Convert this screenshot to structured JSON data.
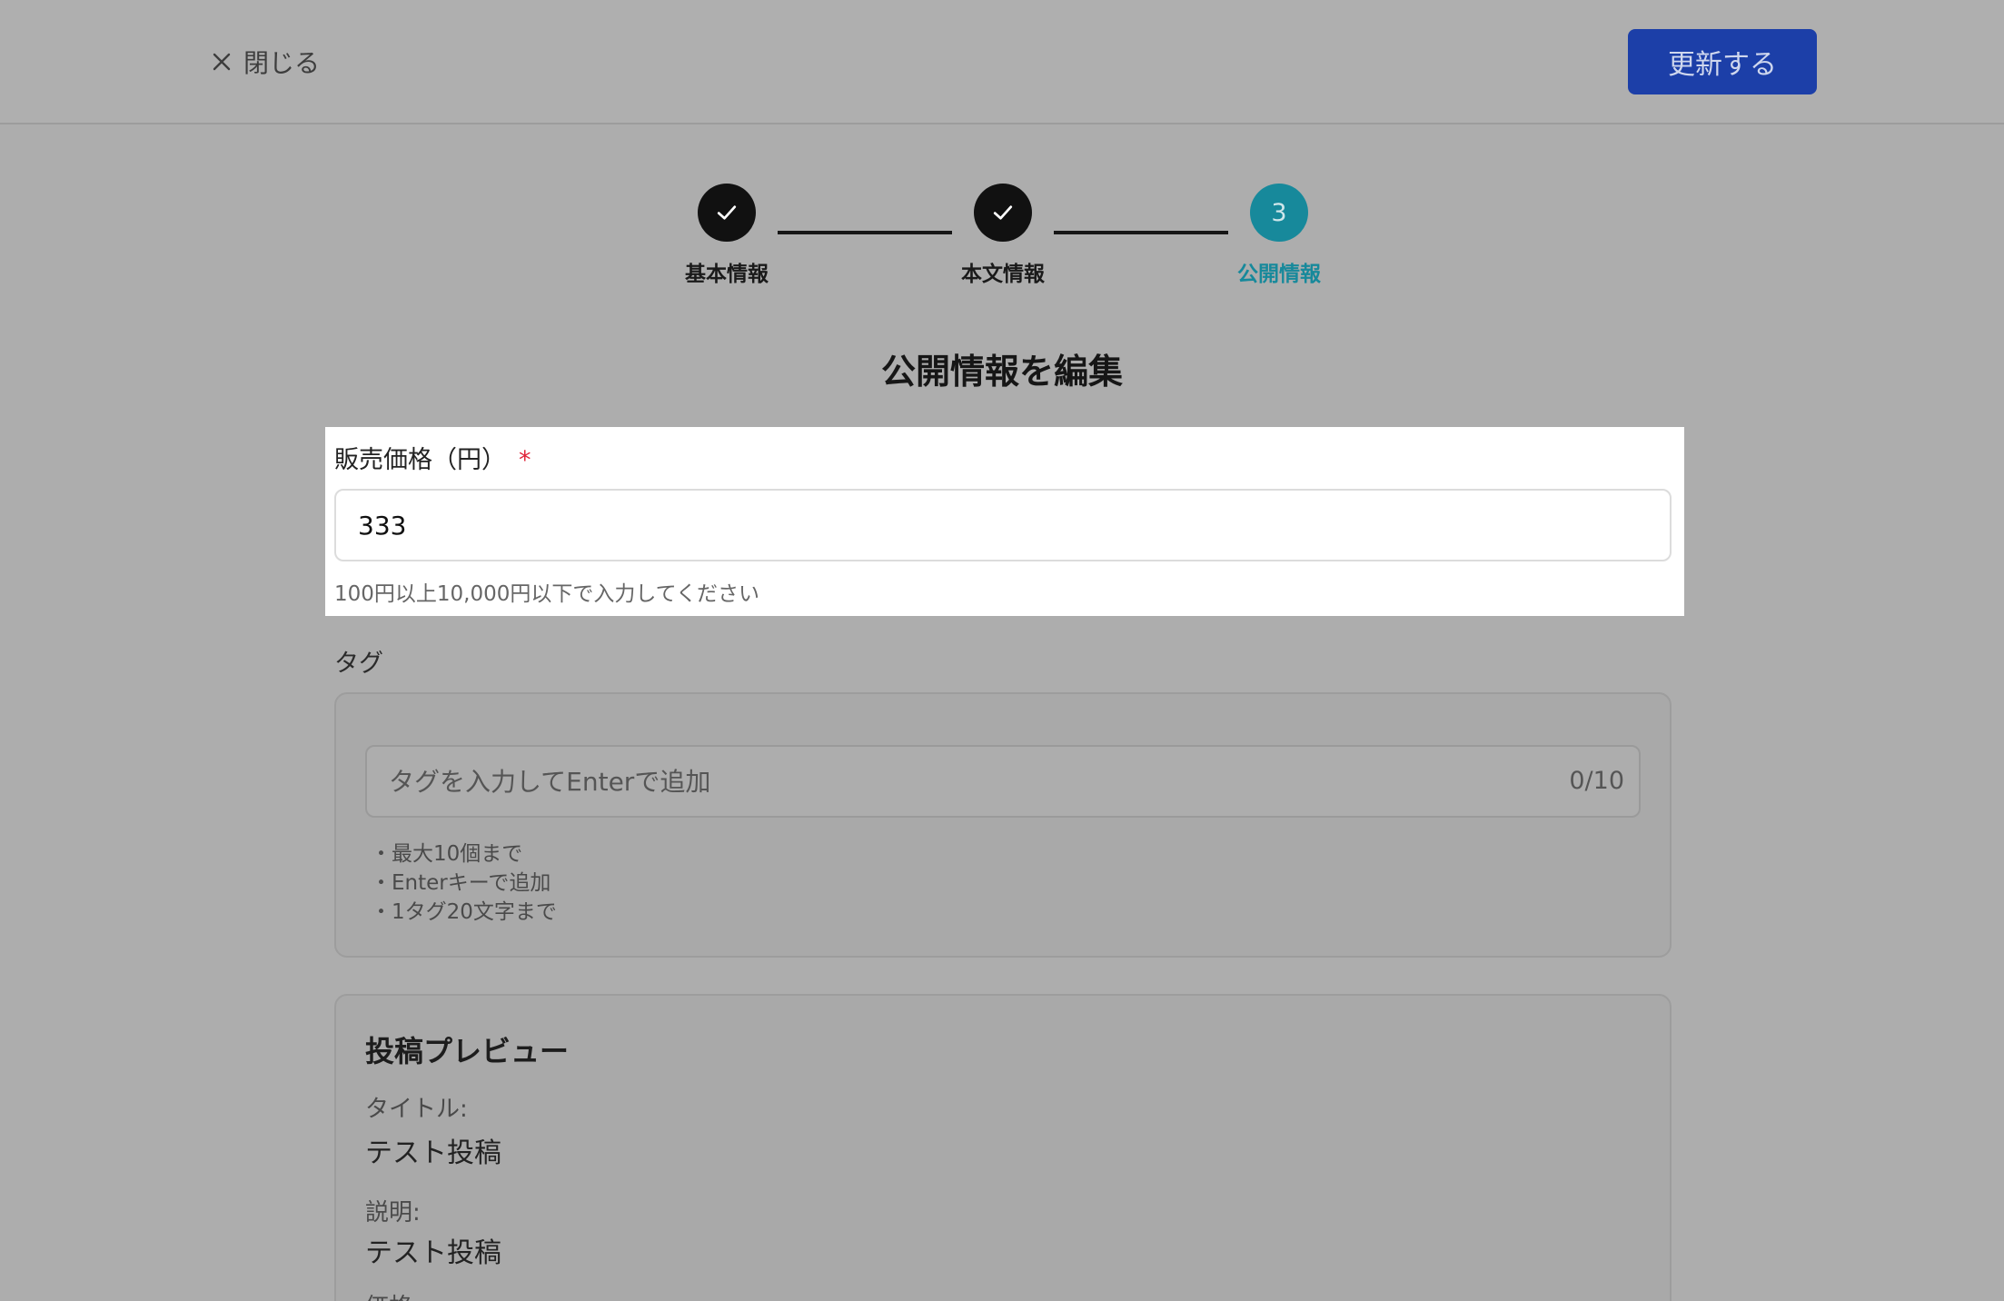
{
  "header": {
    "close_label": "閉じる",
    "update_label": "更新する"
  },
  "stepper": {
    "steps": [
      {
        "label": "基本情報",
        "state": "done"
      },
      {
        "label": "本文情報",
        "state": "done"
      },
      {
        "label": "公開情報",
        "state": "current",
        "number": "3"
      }
    ]
  },
  "page_title": "公開情報を編集",
  "price": {
    "label": "販売価格（円）",
    "required_mark": "*",
    "value": "333",
    "hint": "100円以上10,000円以下で入力してください"
  },
  "tags": {
    "label": "タグ",
    "placeholder": "タグを入力してEnterで追加",
    "counter": "0/10",
    "rules": [
      "・最大10個まで",
      "・Enterキーで追加",
      "・1タグ20文字まで"
    ]
  },
  "preview": {
    "heading": "投稿プレビュー",
    "title_key": "タイトル:",
    "title_value": "テスト投稿",
    "description_key": "説明:",
    "description_value": "テスト投稿",
    "price_key": "価格:"
  },
  "colors": {
    "accent_button": "#1c3fa8",
    "current_step": "#17899b",
    "required": "#e0243a"
  }
}
